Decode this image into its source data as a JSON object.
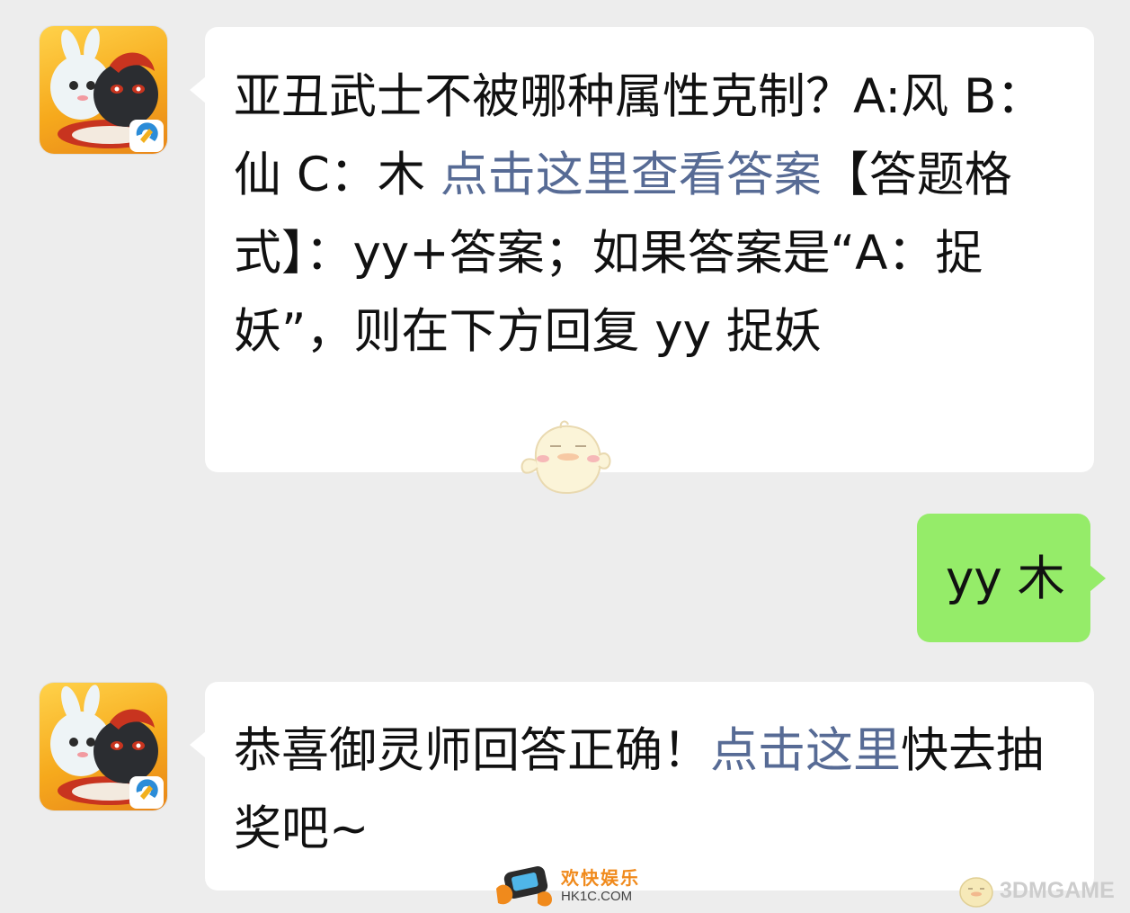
{
  "chat": {
    "messages": [
      {
        "sender": "game-account",
        "parts": [
          {
            "text": "亚丑武士不被哪种属性克制？A:风 B：仙 C：木 "
          },
          {
            "text": "点击这里查看答案"
          },
          {
            "text": "【答题格式】：yy+答案；如果答案是“A：捉妖”，则在下方回复 yy 捉妖"
          }
        ]
      },
      {
        "sender": "me",
        "parts": [
          {
            "text": "yy 木"
          }
        ]
      },
      {
        "sender": "game-account",
        "parts": [
          {
            "text": "恭喜御灵师回答正确！"
          },
          {
            "text": "点击这里"
          },
          {
            "text": "快去抽奖吧~"
          }
        ]
      }
    ]
  },
  "watermarks": {
    "hk1c_title": "欢快娱乐",
    "hk1c_url": "HK1C.COM",
    "threedm": "3DMGAME"
  },
  "colors": {
    "background": "#ededed",
    "bubble_incoming": "#ffffff",
    "bubble_outgoing": "#95ec69",
    "link": "#576b95",
    "text": "#111111"
  }
}
